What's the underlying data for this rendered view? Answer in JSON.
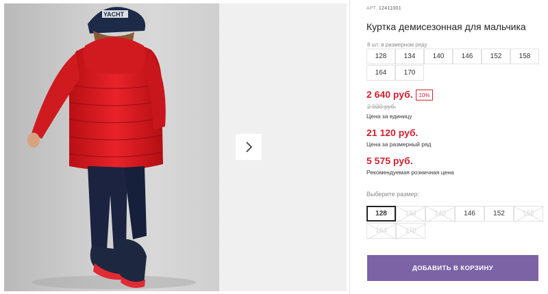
{
  "product": {
    "sku_label": "АРТ.",
    "sku_value": "12411001",
    "title": "Куртка демисезонная для мальчика",
    "row_note": "8 шт. в размерном ряду",
    "size_row": [
      "128",
      "134",
      "140",
      "146",
      "152",
      "158",
      "164",
      "170"
    ]
  },
  "prices": {
    "unit_price": "2 640 руб.",
    "discount": "10%",
    "old_price": "2 930 руб.",
    "unit_label": "Цена за единицу",
    "row_price": "21 120 руб.",
    "row_label": "Цена за размерный ряд",
    "retail_price": "5 575 руб.",
    "retail_label": "Рекомендуемая розничная цена"
  },
  "size_select": {
    "label": "Выберите размер:",
    "options": [
      {
        "label": "128",
        "state": "selected"
      },
      {
        "label": "134",
        "state": "disabled"
      },
      {
        "label": "140",
        "state": "disabled"
      },
      {
        "label": "146",
        "state": "available"
      },
      {
        "label": "152",
        "state": "available"
      },
      {
        "label": "158",
        "state": "disabled"
      },
      {
        "label": "164",
        "state": "disabled"
      },
      {
        "label": "170",
        "state": "disabled"
      }
    ]
  },
  "gallery": {
    "next_icon": "chevron-right-icon",
    "cap_text": "YACHT"
  },
  "cart_button": "ДОБАВИТЬ В КОРЗИНУ",
  "colors": {
    "price_red": "#d0202f",
    "button_purple": "#7b63a6"
  }
}
